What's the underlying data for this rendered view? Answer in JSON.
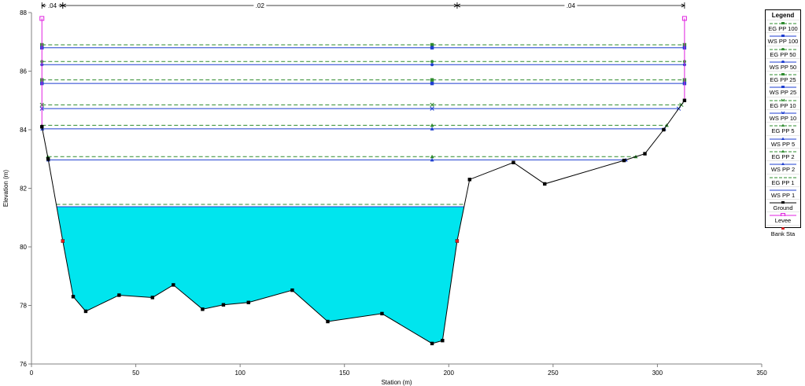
{
  "chart_data": {
    "type": "line",
    "title": "",
    "xlabel": "Station (m)",
    "ylabel": "Elevation (m)",
    "xlim": [
      0,
      350
    ],
    "ylim": [
      76,
      88
    ],
    "xticks": [
      0,
      50,
      100,
      150,
      200,
      250,
      300,
      350
    ],
    "yticks": [
      76,
      78,
      80,
      82,
      84,
      86,
      88
    ],
    "grid": false,
    "legend_position": "right",
    "manning": [
      {
        "label": ".04",
        "from": 5,
        "to": 15
      },
      {
        "label": ".02",
        "from": 15,
        "to": 204
      },
      {
        "label": ".04",
        "from": 204,
        "to": 313
      }
    ],
    "ground": {
      "x": [
        5,
        8,
        15,
        20,
        26,
        42,
        58,
        68,
        82,
        92,
        104,
        125,
        142,
        168,
        192,
        197,
        204,
        210,
        231,
        246,
        284,
        294,
        303,
        313
      ],
      "y": [
        84.1,
        83.0,
        80.2,
        78.3,
        77.8,
        78.35,
        78.27,
        78.7,
        77.87,
        78.02,
        78.1,
        78.52,
        77.45,
        77.72,
        76.7,
        76.8,
        80.2,
        82.3,
        82.88,
        82.15,
        82.95,
        83.18,
        84.0,
        85.0
      ]
    },
    "levee": {
      "x": [
        5,
        313
      ],
      "y": [
        87.8,
        87.8
      ]
    },
    "bank_sta": {
      "x": [
        15,
        204
      ],
      "y": [
        80.2,
        80.2
      ]
    },
    "water_fill_profile": "WS PP 1",
    "profiles": [
      {
        "name": "EG PP 100",
        "y": 86.9,
        "kind": "EG",
        "color": "#2e8b2e",
        "marker": "square"
      },
      {
        "name": "WS PP 100",
        "y": 86.8,
        "kind": "WS",
        "color": "#1f3fd0",
        "marker": "square"
      },
      {
        "name": "EG PP 50",
        "y": 86.33,
        "kind": "EG",
        "color": "#2e8b2e",
        "marker": "circle"
      },
      {
        "name": "WS PP 50",
        "y": 86.22,
        "kind": "WS",
        "color": "#1f3fd0",
        "marker": "circle"
      },
      {
        "name": "EG PP 25",
        "y": 85.7,
        "kind": "EG",
        "color": "#2e8b2e",
        "marker": "square"
      },
      {
        "name": "WS PP 25",
        "y": 85.58,
        "kind": "WS",
        "color": "#1f3fd0",
        "marker": "square"
      },
      {
        "name": "EG PP 10",
        "y": 84.85,
        "kind": "EG",
        "color": "#2e8b2e",
        "marker": "cross"
      },
      {
        "name": "WS PP 10",
        "y": 84.72,
        "kind": "WS",
        "color": "#1f3fd0",
        "marker": "cross"
      },
      {
        "name": "EG PP 5",
        "y": 84.15,
        "kind": "EG",
        "color": "#2e8b2e",
        "marker": "triangle"
      },
      {
        "name": "WS PP 5",
        "y": 84.03,
        "kind": "WS",
        "color": "#1f3fd0",
        "marker": "triangle"
      },
      {
        "name": "EG PP 2",
        "y": 83.08,
        "kind": "EG",
        "color": "#2e8b2e",
        "marker": "triangle"
      },
      {
        "name": "WS PP 2",
        "y": 82.97,
        "kind": "WS",
        "color": "#1f3fd0",
        "marker": "triangle"
      },
      {
        "name": "EG PP 1",
        "y": 81.45,
        "kind": "EG",
        "color": "#2e8b2e",
        "marker": "none"
      },
      {
        "name": "WS PP 1",
        "y": 81.37,
        "kind": "WS",
        "color": "#1f3fd0",
        "marker": "none"
      }
    ],
    "legend": {
      "title": "Legend",
      "items": [
        {
          "label": "EG PP 100",
          "color": "#2e8b2e",
          "style": "dash",
          "marker": "square"
        },
        {
          "label": "WS PP 100",
          "color": "#1f3fd0",
          "style": "solid",
          "marker": "square"
        },
        {
          "label": "EG PP 50",
          "color": "#2e8b2e",
          "style": "dash",
          "marker": "circle"
        },
        {
          "label": "WS PP 50",
          "color": "#1f3fd0",
          "style": "solid",
          "marker": "circle"
        },
        {
          "label": "EG PP 25",
          "color": "#2e8b2e",
          "style": "dash",
          "marker": "square"
        },
        {
          "label": "WS PP 25",
          "color": "#1f3fd0",
          "style": "solid",
          "marker": "square"
        },
        {
          "label": "EG PP 10",
          "color": "#2e8b2e",
          "style": "dash",
          "marker": "cross"
        },
        {
          "label": "WS PP 10",
          "color": "#1f3fd0",
          "style": "solid",
          "marker": "cross"
        },
        {
          "label": "EG PP 5",
          "color": "#2e8b2e",
          "style": "dash",
          "marker": "triangle"
        },
        {
          "label": "WS PP 5",
          "color": "#1f3fd0",
          "style": "solid",
          "marker": "triangle"
        },
        {
          "label": "EG PP 2",
          "color": "#2e8b2e",
          "style": "dash",
          "marker": "triangle"
        },
        {
          "label": "WS PP 2",
          "color": "#1f3fd0",
          "style": "solid",
          "marker": "triangle"
        },
        {
          "label": "EG PP 1",
          "color": "#2e8b2e",
          "style": "dash",
          "marker": "none"
        },
        {
          "label": "WS PP 1",
          "color": "#1f3fd0",
          "style": "solid",
          "marker": "none"
        },
        {
          "label": "Ground",
          "color": "#000000",
          "style": "solid",
          "marker": "square"
        },
        {
          "label": "Levee",
          "color": "#e020e0",
          "style": "solid",
          "marker": "open-square"
        },
        {
          "label": "Bank Sta",
          "color": "#dd2020",
          "style": "none",
          "marker": "circle"
        }
      ]
    },
    "colors": {
      "water": "#00e5ee",
      "ground": "#000000",
      "levee": "#e020e0",
      "bank": "#dd2020",
      "frame": "#808080"
    }
  }
}
